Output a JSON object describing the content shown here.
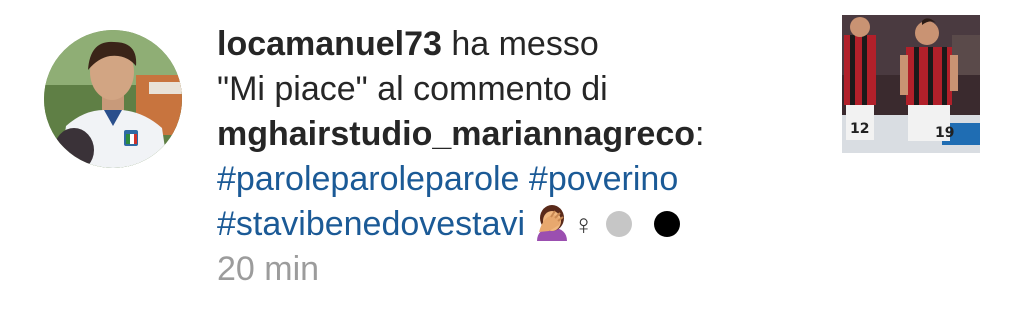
{
  "notification": {
    "username": "locamanuel73",
    "action_text": "ha messo",
    "line2": "\"Mi piace\" al commento di",
    "commenter": "mghairstudio_mariannagreco",
    "colon": ":",
    "hashtag1": "#paroleparoleparole",
    "hashtag2": "#poverino",
    "hashtag3": "#stavibenedovestavi",
    "venus_symbol": "♀",
    "time": "20 min",
    "emoji_name": "face-palm-icon",
    "dot_colors": [
      "#c6c6c6",
      "#000000"
    ],
    "link_color": "#1b5a96"
  },
  "avatar": {
    "icon": "profile-photo"
  },
  "thumbnail": {
    "icon": "post-thumbnail",
    "jersey_numbers": [
      "12",
      "19"
    ]
  }
}
